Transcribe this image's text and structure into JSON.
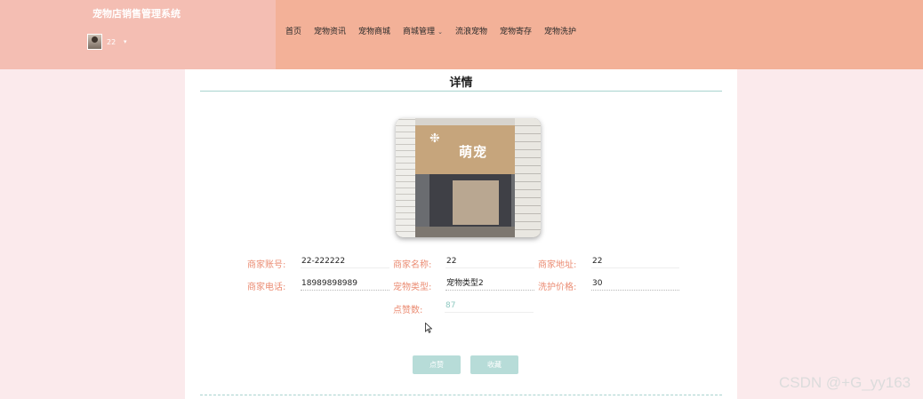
{
  "header": {
    "app_title": "宠物店销售管理系统",
    "username": "22",
    "user_caret": "▾",
    "nav": [
      {
        "label": "首页",
        "has_dropdown": false
      },
      {
        "label": "宠物资讯",
        "has_dropdown": false
      },
      {
        "label": "宠物商城",
        "has_dropdown": false
      },
      {
        "label": "商城管理",
        "has_dropdown": true
      },
      {
        "label": "流浪宠物",
        "has_dropdown": false
      },
      {
        "label": "宠物寄存",
        "has_dropdown": false
      },
      {
        "label": "宠物洗护",
        "has_dropdown": false
      }
    ],
    "dropdown_chevron": "⌄"
  },
  "detail": {
    "page_title": "详情",
    "photo_sign_text": "萌宠",
    "fields": {
      "merchant_account": {
        "label": "商家账号:",
        "value": "22-222222"
      },
      "merchant_name": {
        "label": "商家名称:",
        "value": "22"
      },
      "merchant_address": {
        "label": "商家地址:",
        "value": "22"
      },
      "merchant_phone": {
        "label": "商家电话:",
        "value": "18989898989"
      },
      "pet_type": {
        "label": "宠物类型:",
        "value": "宠物类型2"
      },
      "wash_price": {
        "label": "洗护价格:",
        "value": "30"
      },
      "like_count": {
        "label": "点赞数:",
        "value": "87"
      }
    },
    "buttons": {
      "like": "点赞",
      "favorite": "收藏"
    }
  },
  "watermark": "CSDN @+G_yy163",
  "colors": {
    "header_bg": "#f3b198",
    "brand_bg": "#f4beb3",
    "page_bg": "#fbeaec",
    "label_color": "#eb8c73",
    "accent_teal": "#a9d3cf",
    "button_bg": "#b7dcd8"
  }
}
